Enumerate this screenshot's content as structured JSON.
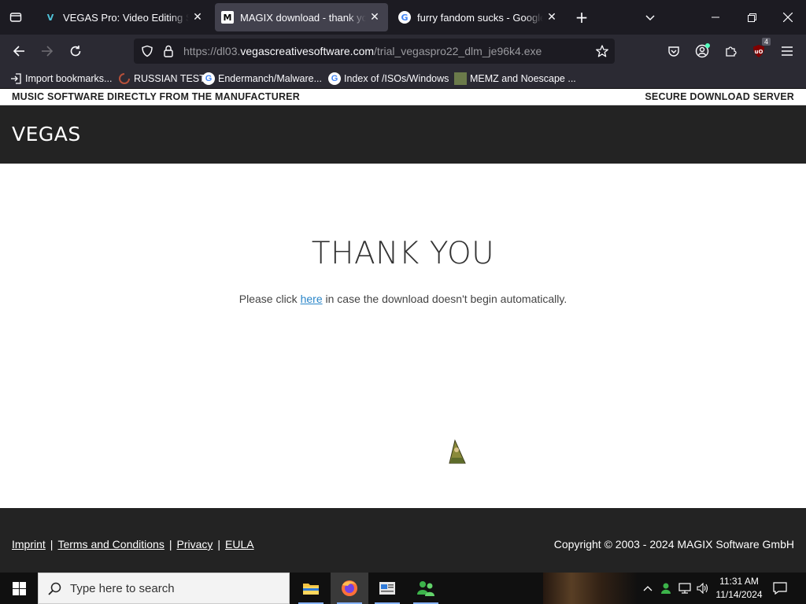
{
  "browser": {
    "tabs": [
      {
        "title": "VEGAS Pro: Video Editing Software",
        "favicon": "V",
        "active": false
      },
      {
        "title": "MAGIX download - thank you",
        "favicon": "M",
        "active": true
      },
      {
        "title": "furry fandom sucks - Google Search",
        "favicon": "G",
        "active": false
      }
    ],
    "url": {
      "prefix": "https://dl03.",
      "domain": "vegascreativesoftware.com",
      "path": "/trial_vegaspro22_dlm_je96k4.exe"
    },
    "extension_badge": "4",
    "bookmarks": [
      {
        "label": "Import bookmarks...",
        "icon": "import-icon"
      },
      {
        "label": "RUSSIAN TEST",
        "icon": "russian-test-favicon"
      },
      {
        "label": "Endermanch/Malware...",
        "icon": "google-favicon"
      },
      {
        "label": "Index of /ISOs/Windows",
        "icon": "google-favicon"
      },
      {
        "label": "MEMZ and Noescape ...",
        "icon": "memz-favicon"
      }
    ]
  },
  "page": {
    "top_left": "MUSIC SOFTWARE DIRECTLY FROM THE MANUFACTURER",
    "top_right": "SECURE DOWNLOAD SERVER",
    "logo": "VEGAS",
    "heading": "THANK YOU",
    "para_before": "Please click ",
    "para_link": "here",
    "para_after": " in case the download doesn't begin automatically.",
    "footer_links": [
      "Imprint",
      "Terms and Conditions",
      "Privacy",
      "EULA"
    ],
    "copyright": "Copyright © 2003 - 2024 MAGIX Software GmbH"
  },
  "taskbar": {
    "search_placeholder": "Type here to search",
    "time": "11:31 AM",
    "date": "11/14/2024"
  },
  "colors": {
    "chrome_dark": "#1c1b22",
    "chrome": "#2b2a33",
    "header": "#232323",
    "link": "#2a86c9"
  }
}
